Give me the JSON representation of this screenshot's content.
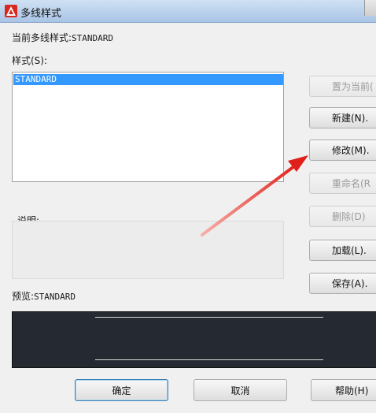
{
  "window": {
    "title": "多线样式"
  },
  "current_style": {
    "label": "当前多线样式:",
    "value": "STANDARD"
  },
  "styles": {
    "label": "样式(S):",
    "items": [
      "STANDARD"
    ]
  },
  "description": {
    "label": "说明:"
  },
  "preview": {
    "label": "预览:",
    "value": "STANDARD"
  },
  "side_buttons": {
    "set_current": "置为当前(",
    "new": "新建(N).",
    "modify": "修改(M).",
    "rename": "重命名(R",
    "delete": "删除(D)",
    "load": "加载(L).",
    "save": "保存(A)."
  },
  "bottom_buttons": {
    "ok": "确定",
    "cancel": "取消",
    "help": "帮助(H)"
  },
  "colors": {
    "selection": "#3399ff",
    "preview_bg": "#252a32",
    "arrow": "#e0201a"
  }
}
